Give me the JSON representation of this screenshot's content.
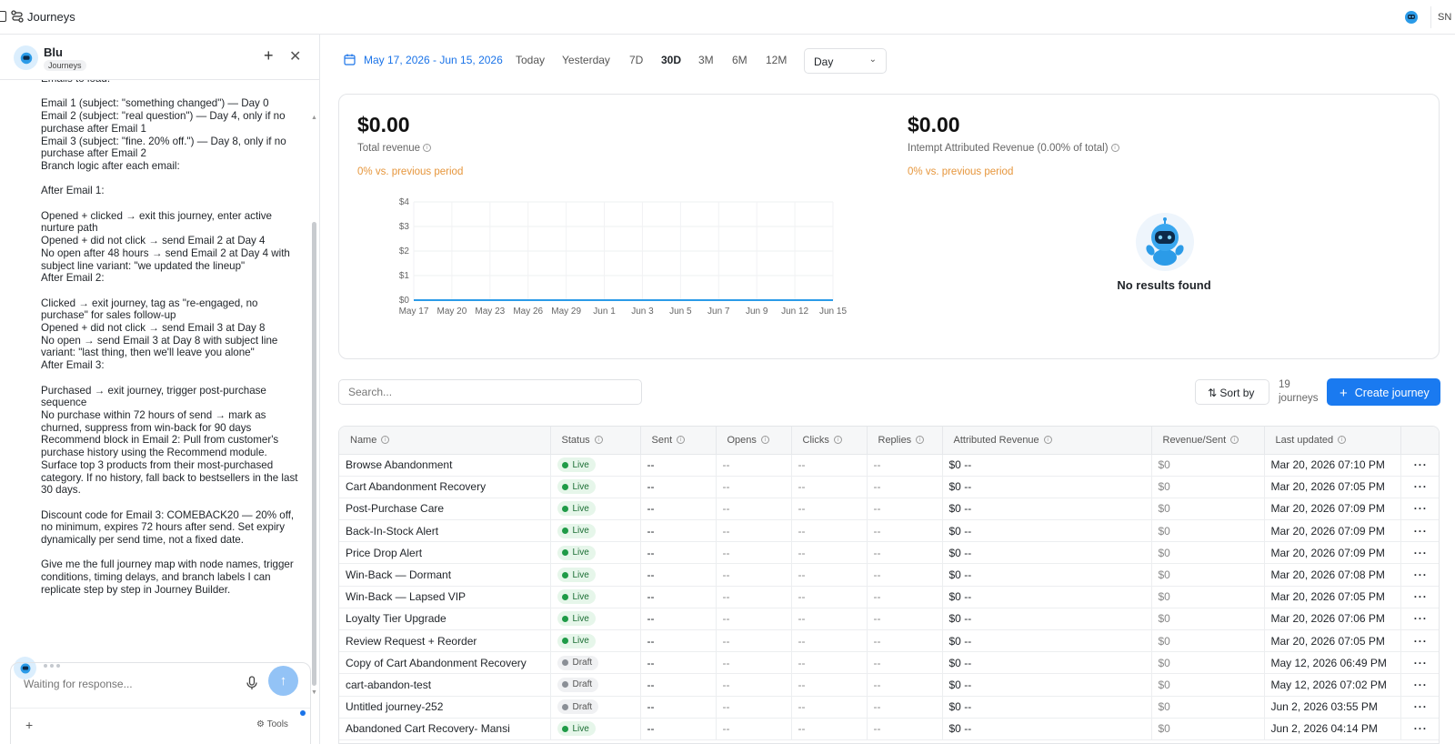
{
  "app": {
    "title": "Journeys",
    "avatar": "SN"
  },
  "chat": {
    "bot_name": "Blu",
    "bot_tag": "Journeys",
    "message": "Emails to load:\n\nEmail 1 (subject: \"something changed\") — Day 0\nEmail 2 (subject: \"real question\") — Day 4, only if no purchase after Email 1\nEmail 3 (subject: \"fine. 20% off.\") — Day 8, only if no purchase after Email 2\nBranch logic after each email:\n\nAfter Email 1:\n\nOpened + clicked → exit this journey, enter active nurture path\nOpened + did not click → send Email 2 at Day 4\nNo open after 48 hours → send Email 2 at Day 4 with subject line variant: \"we updated the lineup\"\nAfter Email 2:\n\nClicked → exit journey, tag as \"re-engaged, no purchase\" for sales follow-up\nOpened + did not click → send Email 3 at Day 8\nNo open → send Email 3 at Day 8 with subject line variant: \"last thing, then we'll leave you alone\"\nAfter Email 3:\n\nPurchased → exit journey, trigger post-purchase sequence\nNo purchase within 72 hours of send → mark as churned, suppress from win-back for 90 days\nRecommend block in Email 2: Pull from customer's purchase history using the Recommend module. Surface top 3 products from their most-purchased category. If no history, fall back to bestsellers in the last 30 days.\n\nDiscount code for Email 3: COMEBACK20 — 20% off, no minimum, expires 72 hours after send. Set expiry dynamically per send time, not a fixed date.\n\nGive me the full journey map with node names, trigger conditions, timing delays, and branch labels I can replicate step by step in Journey Builder.",
    "input_placeholder": "Waiting for response...",
    "tools_label": "Tools"
  },
  "filters": {
    "date_range": "May 17, 2026 - Jun 15, 2026",
    "presets": [
      "Today",
      "Yesterday",
      "7D",
      "30D",
      "3M",
      "6M",
      "12M"
    ],
    "active_preset": "30D",
    "granularity": "Day"
  },
  "revenue": {
    "total": {
      "value": "$0.00",
      "label": "Total revenue",
      "change": "0% vs. previous period"
    },
    "attributed": {
      "value": "$0.00",
      "label": "Intempt Attributed Revenue (0.00% of total)",
      "change": "0% vs. previous period"
    },
    "empty_text": "No results found"
  },
  "chart_data": {
    "type": "line",
    "x": [
      "May 17",
      "May 20",
      "May 23",
      "May 26",
      "May 29",
      "Jun 1",
      "Jun 3",
      "Jun 5",
      "Jun 7",
      "Jun 9",
      "Jun 12",
      "Jun 15"
    ],
    "series": [
      {
        "values": [
          0,
          0,
          0,
          0,
          0,
          0,
          0,
          0,
          0,
          0,
          0,
          0
        ]
      }
    ],
    "y_ticks": [
      "$0",
      "$1",
      "$2",
      "$3",
      "$4"
    ],
    "ylim": [
      0,
      4
    ],
    "grid": true,
    "line_color": "#2b9be8"
  },
  "toolbar": {
    "search_placeholder": "Search...",
    "sort_label": "Sort by",
    "count": "19 journeys",
    "create_label": "Create journey"
  },
  "table": {
    "columns": [
      "Name",
      "Status",
      "Sent",
      "Opens",
      "Clicks",
      "Replies",
      "Attributed Revenue",
      "Revenue/Sent",
      "Last updated"
    ],
    "rows": [
      {
        "name": "Browse Abandonment",
        "status": "Live",
        "updated": "Mar 20, 2026 07:10 PM"
      },
      {
        "name": "Cart Abandonment Recovery",
        "status": "Live",
        "updated": "Mar 20, 2026 07:05 PM"
      },
      {
        "name": "Post-Purchase Care",
        "status": "Live",
        "updated": "Mar 20, 2026 07:09 PM"
      },
      {
        "name": "Back-In-Stock Alert",
        "status": "Live",
        "updated": "Mar 20, 2026 07:09 PM"
      },
      {
        "name": "Price Drop Alert",
        "status": "Live",
        "updated": "Mar 20, 2026 07:09 PM"
      },
      {
        "name": "Win-Back — Dormant",
        "status": "Live",
        "updated": "Mar 20, 2026 07:08 PM"
      },
      {
        "name": "Win-Back — Lapsed VIP",
        "status": "Live",
        "updated": "Mar 20, 2026 07:05 PM"
      },
      {
        "name": "Loyalty Tier Upgrade",
        "status": "Live",
        "updated": "Mar 20, 2026 07:06 PM"
      },
      {
        "name": "Review Request + Reorder",
        "status": "Live",
        "updated": "Mar 20, 2026 07:05 PM"
      },
      {
        "name": "Copy of Cart Abandonment Recovery",
        "status": "Draft",
        "updated": "May 12, 2026 06:49 PM"
      },
      {
        "name": "cart-abandon-test",
        "status": "Draft",
        "updated": "May 12, 2026 07:02 PM"
      },
      {
        "name": "Untitled journey-252",
        "status": "Draft",
        "updated": "Jun 2, 2026 03:55 PM"
      },
      {
        "name": "Abandoned Cart Recovery- Mansi",
        "status": "Live",
        "updated": "Jun 2, 2026 04:14 PM"
      }
    ],
    "sent": "--",
    "opens": "--",
    "clicks": "--",
    "replies": "--",
    "attributed_value": "$0",
    "attributed_dash": "--",
    "rev_per_sent": "$0",
    "more": "···"
  },
  "colors": {
    "accent": "#1a7af0",
    "link": "#1a73e8",
    "change": "#e6963c",
    "live": "#1f9b47"
  }
}
